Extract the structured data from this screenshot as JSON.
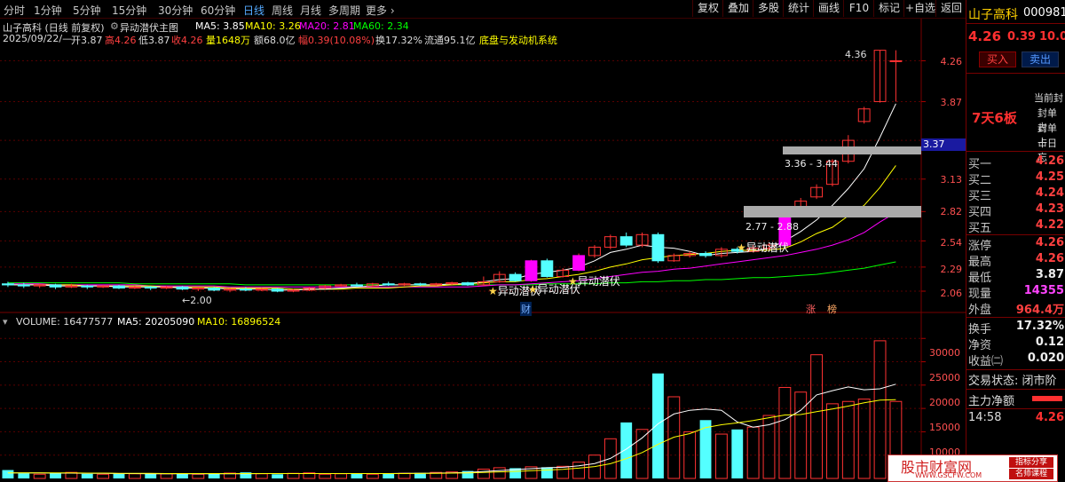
{
  "tabs": [
    "分时",
    "1分钟",
    "5分钟",
    "15分钟",
    "30分钟",
    "60分钟",
    "日线",
    "周线",
    "月线",
    "多周期",
    "更多 ›"
  ],
  "active_tab": "日线",
  "toolbar_buttons": [
    "复权",
    "叠加",
    "多股",
    "统计",
    "画线",
    "F10",
    "标记",
    "+自选",
    "返回"
  ],
  "chart_header": {
    "stock_title": "山子高科 (日线 前复权)",
    "indicator_name": "异动潜伏主图",
    "ma5": "MA5: 3.85",
    "ma10": "MA10: 3.26",
    "ma20": "MA20: 2.81",
    "ma60": "MA60: 2.34",
    "date": "2025/09/22/—",
    "open": "开3.87",
    "high": "高4.26",
    "low": "低3.87",
    "close": "收4.26",
    "volume": "量1648万",
    "amount": "额68.0亿",
    "change": "幅0.39(10.08%)",
    "turnover": "换17.32%",
    "float": "流通95.1亿",
    "formula": "底盘与发动机系统"
  },
  "price_axis": [
    "4.26",
    "3.87",
    "3.50",
    "3.13",
    "2.82",
    "2.54",
    "2.29",
    "2.06"
  ],
  "current_price_tag": "3.37",
  "annotations": {
    "high_label": "4.36",
    "zone1": "3.36 - 3.44",
    "zone2": "2.77 - 2.88",
    "low_label": "←2.00",
    "signal": "异动潜伏",
    "flag_cai": "财",
    "flag_zhang": "涨",
    "flag_bang": "榜"
  },
  "volume_header": {
    "volume": "VOLUME: 16477577",
    "ma5": "MA5: 20205090",
    "ma10": "MA10: 16896524"
  },
  "volume_axis": [
    "30000",
    "25000",
    "20000",
    "15000",
    "10000",
    "5000"
  ],
  "colors": {
    "up": "#ff3232",
    "down": "#54ffff",
    "ma5": "#ffffff",
    "ma10": "#ffff00",
    "ma20": "#ff00ff",
    "ma60": "#00ff00",
    "signal": "#ff00ff"
  },
  "side": {
    "name": "山子高科",
    "code": "000981",
    "price": "4.26",
    "change": "0.39",
    "pct": "10.0",
    "buy_btn": "买入",
    "sell_btn": "卖出",
    "board_tag": "7天6板",
    "notes": [
      "当前封",
      "封单占",
      "封单占",
      "十日忘"
    ],
    "bids": [
      {
        "k": "买一",
        "v": "4.26"
      },
      {
        "k": "买二",
        "v": "4.25"
      },
      {
        "k": "买三",
        "v": "4.24"
      },
      {
        "k": "买四",
        "v": "4.23"
      },
      {
        "k": "买五",
        "v": "4.22"
      }
    ],
    "stats": [
      {
        "k": "涨停",
        "v": "4.26"
      },
      {
        "k": "最高",
        "v": "4.26"
      },
      {
        "k": "最低",
        "v": "3.87"
      },
      {
        "k": "现量",
        "v": "14355"
      },
      {
        "k": "外盘",
        "v": "964.4万"
      }
    ],
    "stats2": [
      {
        "k": "换手",
        "v": "17.32%"
      },
      {
        "k": "净资",
        "v": "0.12"
      },
      {
        "k": "收益㈡",
        "v": "0.020"
      }
    ],
    "trade_status": "交易状态: 闭市阶",
    "main_flow": "主力净额",
    "time": "14:58",
    "time_price": "4.26"
  },
  "watermark": {
    "site": "股市财富网",
    "url": "WWW.GSCFW.COM",
    "tag1": "指标分享",
    "tag2": "名师课程"
  },
  "chart_data": {
    "type": "candlestick",
    "price_ylim": [
      1.95,
      4.45
    ],
    "volume_ylim": [
      0,
      31000
    ],
    "candles": [
      [
        2.13,
        2.12,
        2.15,
        2.1
      ],
      [
        2.12,
        2.11,
        2.14,
        2.09
      ],
      [
        2.11,
        2.12,
        2.13,
        2.09
      ],
      [
        2.12,
        2.1,
        2.13,
        2.08
      ],
      [
        2.1,
        2.11,
        2.13,
        2.09
      ],
      [
        2.11,
        2.1,
        2.12,
        2.08
      ],
      [
        2.1,
        2.11,
        2.12,
        2.09
      ],
      [
        2.11,
        2.09,
        2.12,
        2.08
      ],
      [
        2.09,
        2.1,
        2.11,
        2.08
      ],
      [
        2.1,
        2.09,
        2.11,
        2.07
      ],
      [
        2.09,
        2.1,
        2.11,
        2.08
      ],
      [
        2.1,
        2.08,
        2.11,
        2.07
      ],
      [
        2.08,
        2.09,
        2.1,
        2.06
      ],
      [
        2.09,
        2.07,
        2.1,
        2.06
      ],
      [
        2.07,
        2.08,
        2.09,
        2.05
      ],
      [
        2.08,
        2.07,
        2.1,
        2.06
      ],
      [
        2.07,
        2.08,
        2.09,
        2.06
      ],
      [
        2.08,
        2.06,
        2.09,
        2.05
      ],
      [
        2.06,
        2.07,
        2.08,
        2.05
      ],
      [
        2.07,
        2.09,
        2.1,
        2.06
      ],
      [
        2.09,
        2.11,
        2.12,
        2.08
      ],
      [
        2.11,
        2.12,
        2.13,
        2.1
      ],
      [
        2.12,
        2.11,
        2.14,
        2.1
      ],
      [
        2.11,
        2.13,
        2.14,
        2.1
      ],
      [
        2.13,
        2.12,
        2.15,
        2.11
      ],
      [
        2.12,
        2.13,
        2.14,
        2.11
      ],
      [
        2.13,
        2.12,
        2.14,
        2.11
      ],
      [
        2.12,
        2.13,
        2.14,
        2.11
      ],
      [
        2.13,
        2.14,
        2.15,
        2.12
      ],
      [
        2.14,
        2.12,
        2.15,
        2.11
      ],
      [
        2.12,
        2.15,
        2.2,
        2.11
      ],
      [
        2.15,
        2.22,
        2.25,
        2.14
      ],
      [
        2.22,
        2.16,
        2.24,
        2.15
      ],
      [
        2.16,
        2.35,
        2.36,
        2.15
      ],
      [
        2.35,
        2.2,
        2.37,
        2.19
      ],
      [
        2.2,
        2.26,
        2.28,
        2.19
      ],
      [
        2.26,
        2.4,
        2.42,
        2.25
      ],
      [
        2.4,
        2.48,
        2.5,
        2.38
      ],
      [
        2.48,
        2.58,
        2.6,
        2.46
      ],
      [
        2.58,
        2.5,
        2.62,
        2.48
      ],
      [
        2.5,
        2.6,
        2.62,
        2.48
      ],
      [
        2.6,
        2.35,
        2.62,
        2.33
      ],
      [
        2.35,
        2.4,
        2.42,
        2.34
      ],
      [
        2.4,
        2.42,
        2.44,
        2.38
      ],
      [
        2.42,
        2.4,
        2.44,
        2.38
      ],
      [
        2.4,
        2.46,
        2.48,
        2.38
      ],
      [
        2.46,
        2.44,
        2.48,
        2.42
      ],
      [
        2.44,
        2.47,
        2.5,
        2.43
      ],
      [
        2.47,
        2.5,
        2.52,
        2.45
      ],
      [
        2.5,
        2.8,
        2.82,
        2.48
      ],
      [
        2.8,
        2.92,
        2.95,
        2.78
      ],
      [
        2.96,
        3.05,
        3.08,
        2.94
      ],
      [
        3.08,
        3.3,
        3.32,
        3.06
      ],
      [
        3.3,
        3.5,
        3.55,
        3.28
      ],
      [
        3.68,
        3.8,
        3.82,
        3.66
      ],
      [
        3.87,
        4.36,
        4.36,
        3.86
      ],
      [
        4.26,
        4.26,
        4.36,
        3.87
      ]
    ],
    "volumes": [
      1800,
      1100,
      900,
      1200,
      1300,
      1000,
      900,
      1100,
      1000,
      950,
      1000,
      1100,
      900,
      1050,
      1150,
      1300,
      1000,
      900,
      1100,
      1200,
      900,
      1000,
      1100,
      900,
      1000,
      1100,
      1200,
      1300,
      1400,
      1600,
      2000,
      2300,
      2200,
      2500,
      2400,
      2600,
      3500,
      5000,
      8500,
      12000,
      10500,
      22500,
      17500,
      10000,
      12500,
      9500,
      10500,
      11000,
      13500,
      19500,
      18500,
      26500,
      16000,
      16500,
      17000,
      29500,
      16500
    ],
    "ma5": [
      2.12,
      2.12,
      2.12,
      2.11,
      2.11,
      2.11,
      2.11,
      2.1,
      2.1,
      2.1,
      2.1,
      2.09,
      2.09,
      2.09,
      2.08,
      2.08,
      2.08,
      2.07,
      2.07,
      2.08,
      2.08,
      2.09,
      2.1,
      2.11,
      2.12,
      2.12,
      2.12,
      2.12,
      2.13,
      2.13,
      2.15,
      2.17,
      2.18,
      2.22,
      2.24,
      2.26,
      2.29,
      2.35,
      2.43,
      2.46,
      2.5,
      2.48,
      2.47,
      2.44,
      2.4,
      2.42,
      2.43,
      2.44,
      2.47,
      2.54,
      2.63,
      2.74,
      2.88,
      3.04,
      3.23,
      3.53,
      3.85
    ],
    "ma10": [
      2.12,
      2.12,
      2.12,
      2.12,
      2.12,
      2.11,
      2.11,
      2.11,
      2.11,
      2.11,
      2.1,
      2.1,
      2.1,
      2.1,
      2.09,
      2.09,
      2.09,
      2.09,
      2.08,
      2.08,
      2.08,
      2.08,
      2.09,
      2.09,
      2.09,
      2.1,
      2.11,
      2.11,
      2.12,
      2.13,
      2.14,
      2.15,
      2.15,
      2.17,
      2.18,
      2.2,
      2.22,
      2.25,
      2.29,
      2.32,
      2.36,
      2.38,
      2.4,
      2.41,
      2.42,
      2.44,
      2.45,
      2.45,
      2.45,
      2.47,
      2.53,
      2.61,
      2.67,
      2.78,
      2.88,
      3.05,
      3.26
    ],
    "ma20": [
      2.13,
      2.13,
      2.13,
      2.12,
      2.12,
      2.12,
      2.12,
      2.12,
      2.12,
      2.11,
      2.11,
      2.11,
      2.11,
      2.11,
      2.1,
      2.1,
      2.1,
      2.1,
      2.1,
      2.1,
      2.1,
      2.1,
      2.1,
      2.1,
      2.1,
      2.1,
      2.1,
      2.1,
      2.1,
      2.1,
      2.11,
      2.12,
      2.12,
      2.13,
      2.14,
      2.15,
      2.16,
      2.18,
      2.2,
      2.22,
      2.24,
      2.25,
      2.27,
      2.28,
      2.3,
      2.32,
      2.34,
      2.36,
      2.38,
      2.4,
      2.43,
      2.46,
      2.5,
      2.55,
      2.62,
      2.72,
      2.81
    ],
    "ma60": [
      2.14,
      2.14,
      2.14,
      2.14,
      2.14,
      2.14,
      2.14,
      2.14,
      2.13,
      2.13,
      2.13,
      2.13,
      2.13,
      2.13,
      2.13,
      2.12,
      2.12,
      2.12,
      2.12,
      2.12,
      2.12,
      2.12,
      2.12,
      2.12,
      2.12,
      2.12,
      2.12,
      2.12,
      2.12,
      2.12,
      2.12,
      2.12,
      2.12,
      2.12,
      2.13,
      2.13,
      2.13,
      2.13,
      2.14,
      2.14,
      2.15,
      2.15,
      2.16,
      2.16,
      2.17,
      2.17,
      2.18,
      2.19,
      2.19,
      2.2,
      2.21,
      2.22,
      2.24,
      2.26,
      2.28,
      2.31,
      2.34
    ],
    "vol_ma5": [
      1200,
      1200,
      1200,
      1150,
      1150,
      1100,
      1100,
      1050,
      1050,
      1000,
      1000,
      1000,
      1000,
      1000,
      1000,
      1000,
      1050,
      1050,
      1050,
      1050,
      1050,
      1050,
      1050,
      1050,
      1050,
      1100,
      1100,
      1150,
      1200,
      1300,
      1500,
      1700,
      1900,
      2100,
      2300,
      2400,
      2700,
      3200,
      4300,
      6300,
      8700,
      11700,
      13800,
      14600,
      14900,
      14600,
      12100,
      11000,
      11500,
      12600,
      14600,
      17900,
      18800,
      19600,
      19000,
      19200,
      20205
    ],
    "vol_ma10": [
      1200,
      1200,
      1200,
      1200,
      1200,
      1150,
      1150,
      1100,
      1100,
      1100,
      1050,
      1050,
      1050,
      1050,
      1050,
      1050,
      1050,
      1050,
      1050,
      1050,
      1050,
      1050,
      1050,
      1050,
      1050,
      1050,
      1100,
      1100,
      1150,
      1200,
      1300,
      1400,
      1500,
      1650,
      1800,
      1950,
      2200,
      2550,
      3150,
      4250,
      5550,
      7300,
      8850,
      9600,
      10900,
      11500,
      11900,
      12400,
      13000,
      13600,
      13700,
      14300,
      14900,
      15500,
      16200,
      16800,
      16897
    ]
  }
}
